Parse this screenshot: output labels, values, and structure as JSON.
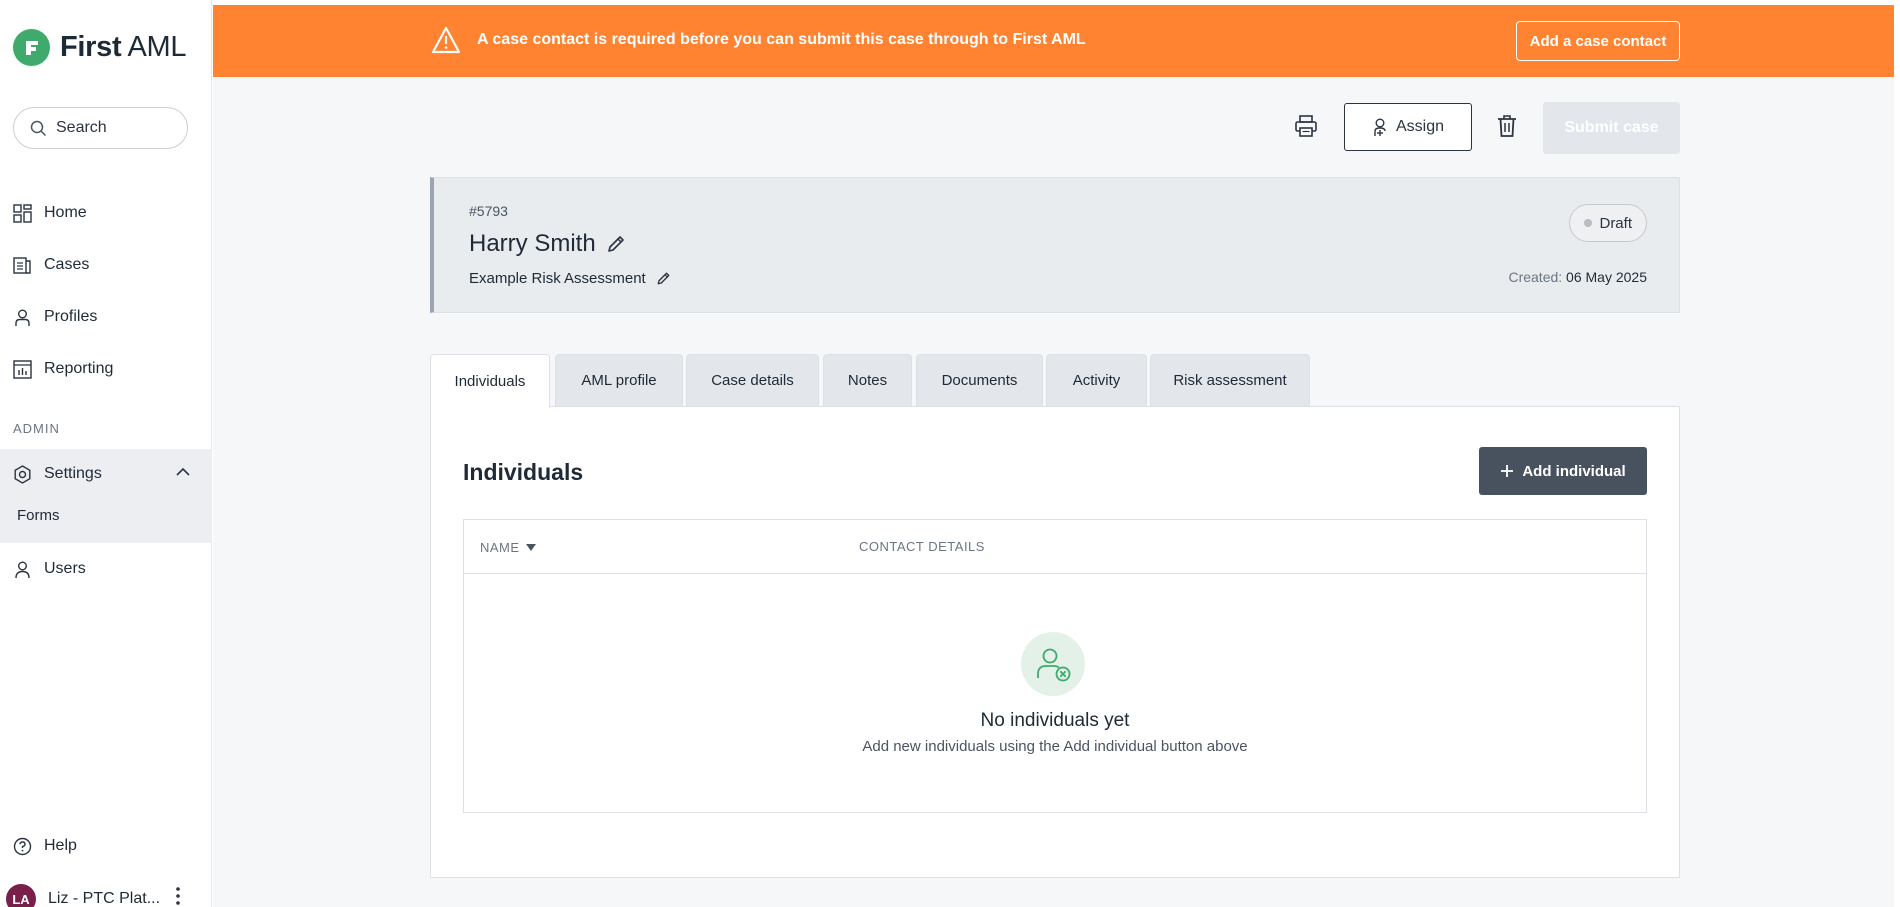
{
  "brand": {
    "name_bold": "First",
    "name_light": " AML"
  },
  "sidebar": {
    "search_label": "Search",
    "items": [
      {
        "label": "Home",
        "icon": "dashboard-icon"
      },
      {
        "label": "Cases",
        "icon": "cases-icon"
      },
      {
        "label": "Profiles",
        "icon": "profile-icon"
      },
      {
        "label": "Reporting",
        "icon": "reporting-icon"
      }
    ],
    "admin_label": "ADMIN",
    "settings_label": "Settings",
    "forms_label": "Forms",
    "users_label": "Users",
    "help_label": "Help",
    "user": {
      "initials": "LA",
      "name": "Liz - PTC Plat..."
    }
  },
  "banner": {
    "message": "A case contact is required before you can submit this case through to First AML",
    "button_label": "Add a case contact",
    "color": "#ff8330"
  },
  "toolbar": {
    "assign_label": "Assign",
    "submit_label": "Submit case"
  },
  "case": {
    "id": "#5793",
    "name": "Harry Smith",
    "subtitle": "Example Risk Assessment",
    "status": "Draft",
    "created_label": "Created:",
    "created_date": "06 May 2025"
  },
  "tabs": [
    {
      "label": "Individuals",
      "active": true
    },
    {
      "label": "AML profile",
      "active": false
    },
    {
      "label": "Case details",
      "active": false
    },
    {
      "label": "Notes",
      "active": false
    },
    {
      "label": "Documents",
      "active": false
    },
    {
      "label": "Activity",
      "active": false
    },
    {
      "label": "Risk assessment",
      "active": false
    }
  ],
  "individuals": {
    "title": "Individuals",
    "add_button_label": "Add individual",
    "columns": [
      "NAME",
      "CONTACT DETAILS"
    ],
    "empty_title": "No individuals yet",
    "empty_subtitle": "Add new individuals using the Add individual button above"
  }
}
